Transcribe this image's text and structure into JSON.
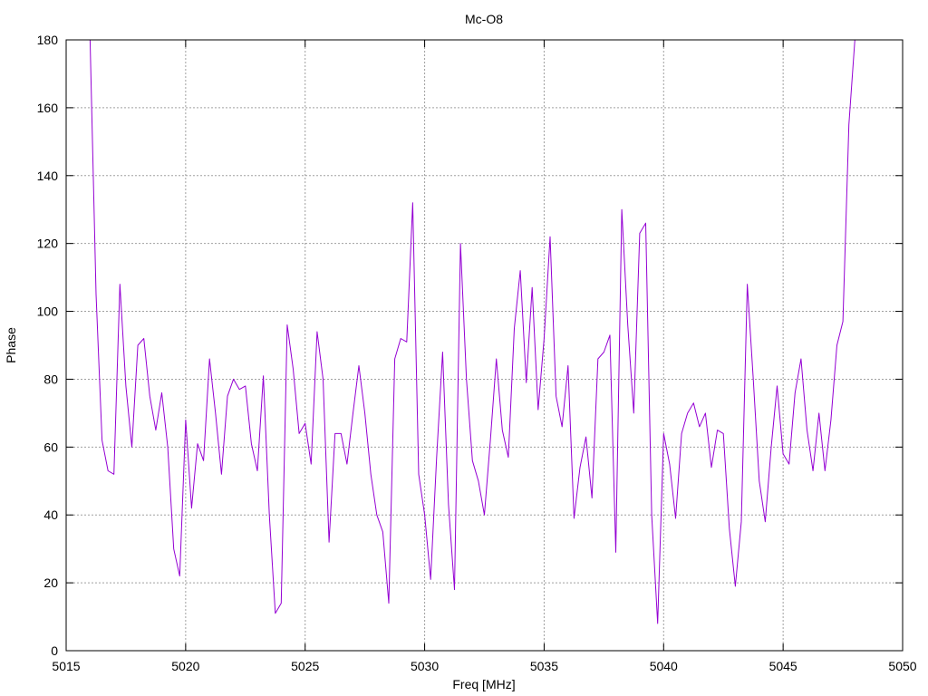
{
  "chart_data": {
    "type": "line",
    "title": "Mc-O8",
    "xlabel": "Freq [MHz]",
    "ylabel": "Phase",
    "xlim": [
      5015,
      5050
    ],
    "ylim": [
      0,
      180
    ],
    "xticks": [
      5015,
      5020,
      5025,
      5030,
      5035,
      5040,
      5045,
      5050
    ],
    "yticks": [
      0,
      20,
      40,
      60,
      80,
      100,
      120,
      140,
      160,
      180
    ],
    "grid": true,
    "series": [
      {
        "color": "#9400d3",
        "x": [
          5016.0,
          5016.25,
          5016.5,
          5016.75,
          5017.0,
          5017.25,
          5017.5,
          5017.75,
          5018.0,
          5018.25,
          5018.5,
          5018.75,
          5019.0,
          5019.25,
          5019.5,
          5019.75,
          5020.0,
          5020.25,
          5020.5,
          5020.75,
          5021.0,
          5021.25,
          5021.5,
          5021.75,
          5022.0,
          5022.25,
          5022.5,
          5022.75,
          5023.0,
          5023.25,
          5023.5,
          5023.75,
          5024.0,
          5024.25,
          5024.5,
          5024.75,
          5025.0,
          5025.25,
          5025.5,
          5025.75,
          5026.0,
          5026.25,
          5026.5,
          5026.75,
          5027.0,
          5027.25,
          5027.5,
          5027.75,
          5028.0,
          5028.25,
          5028.5,
          5028.75,
          5029.0,
          5029.25,
          5029.5,
          5029.75,
          5030.0,
          5030.25,
          5030.5,
          5030.75,
          5031.0,
          5031.25,
          5031.5,
          5031.75,
          5032.0,
          5032.25,
          5032.5,
          5032.75,
          5033.0,
          5033.25,
          5033.5,
          5033.75,
          5034.0,
          5034.25,
          5034.5,
          5034.75,
          5035.0,
          5035.25,
          5035.5,
          5035.75,
          5036.0,
          5036.25,
          5036.5,
          5036.75,
          5037.0,
          5037.25,
          5037.5,
          5037.75,
          5038.0,
          5038.25,
          5038.5,
          5038.75,
          5039.0,
          5039.25,
          5039.5,
          5039.75,
          5040.0,
          5040.25,
          5040.5,
          5040.75,
          5041.0,
          5041.25,
          5041.5,
          5041.75,
          5042.0,
          5042.25,
          5042.5,
          5042.75,
          5043.0,
          5043.25,
          5043.5,
          5043.75,
          5044.0,
          5044.25,
          5044.5,
          5044.75,
          5045.0,
          5045.25,
          5045.5,
          5045.75,
          5046.0,
          5046.25,
          5046.5,
          5046.75,
          5047.0,
          5047.25,
          5047.5,
          5047.75,
          5048.0
        ],
        "y": [
          180,
          105,
          62,
          53,
          52,
          108,
          78,
          60,
          90,
          92,
          75,
          65,
          76,
          60,
          30,
          22,
          68,
          42,
          61,
          56,
          86,
          70,
          52,
          75,
          80,
          77,
          78,
          61,
          53,
          81,
          40,
          11,
          14,
          96,
          83,
          64,
          67,
          55,
          94,
          80,
          32,
          64,
          64,
          55,
          70,
          84,
          70,
          52,
          40,
          35,
          14,
          86,
          92,
          91,
          132,
          52,
          40,
          21,
          57,
          88,
          43,
          18,
          120,
          80,
          56,
          50,
          40,
          62,
          86,
          65,
          57,
          95,
          112,
          79,
          107,
          71,
          92,
          122,
          75,
          66,
          84,
          39,
          54,
          63,
          45,
          86,
          88,
          93,
          29,
          130,
          96,
          70,
          123,
          126,
          40,
          8,
          64,
          55,
          39,
          64,
          70,
          73,
          66,
          70,
          54,
          65,
          64,
          36,
          19,
          38,
          108,
          80,
          50,
          38,
          60,
          78,
          58,
          55,
          76,
          86,
          65,
          53,
          70,
          53,
          68,
          90,
          97,
          155,
          180
        ]
      }
    ]
  }
}
